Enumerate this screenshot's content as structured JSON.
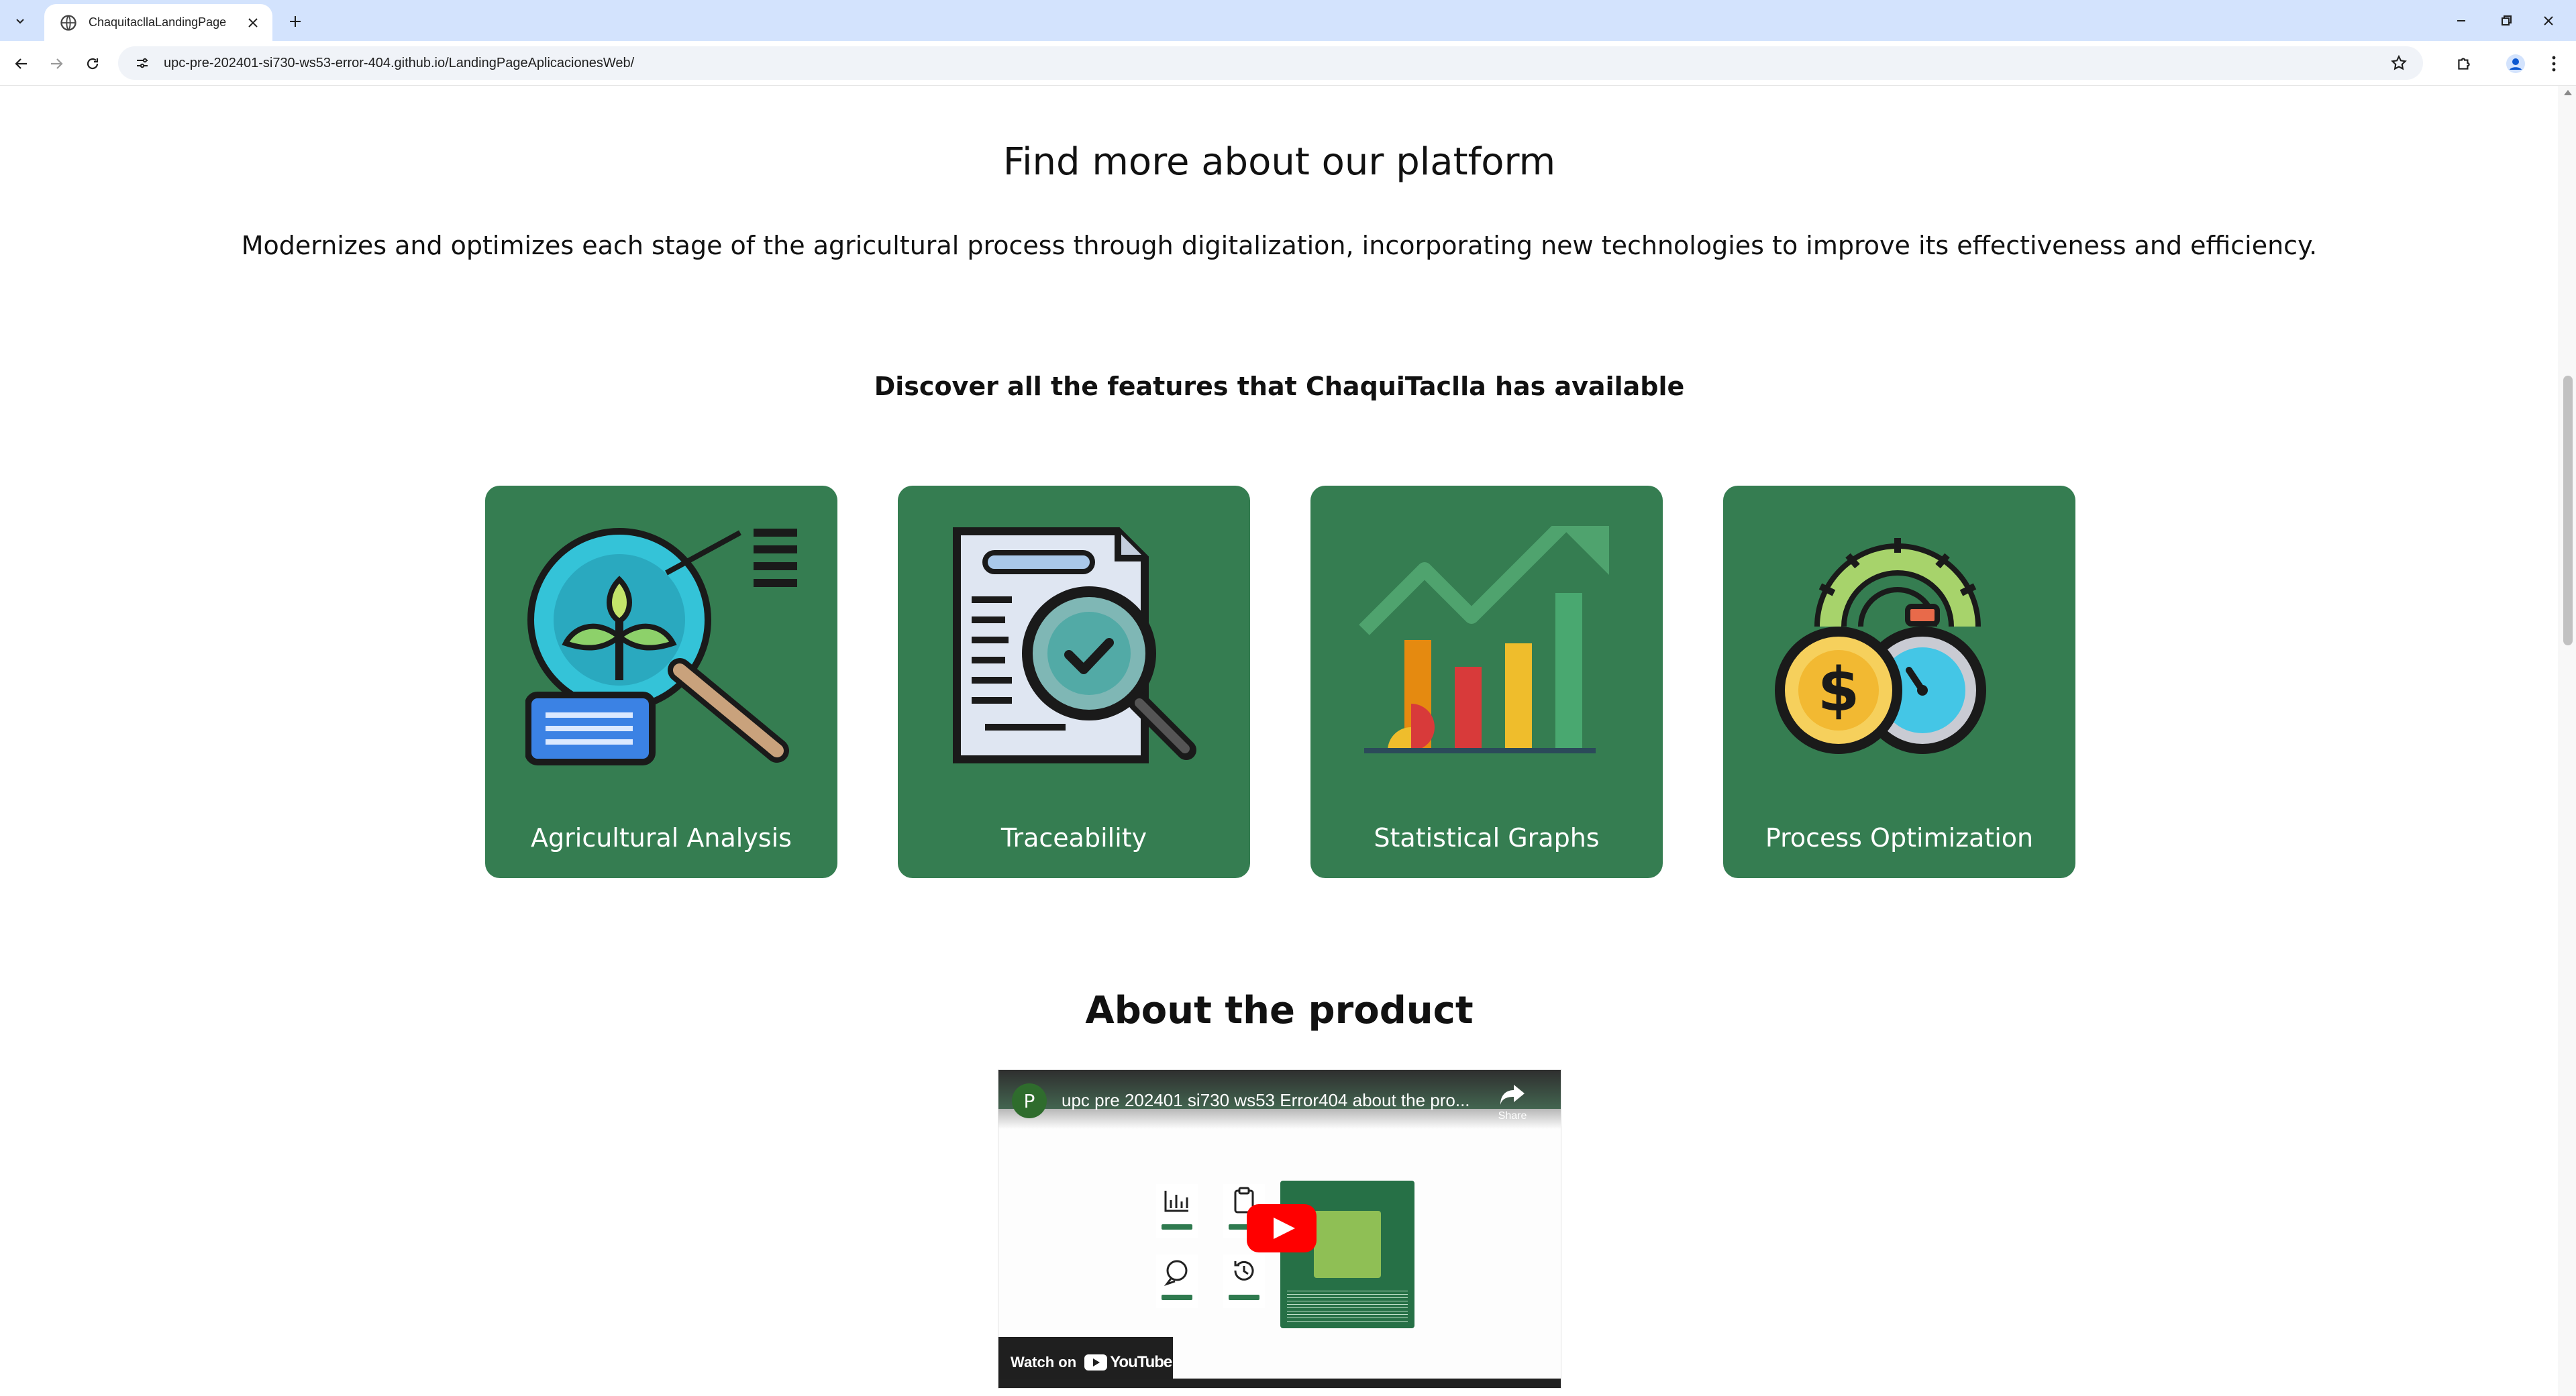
{
  "browser": {
    "tab_title": "ChaquitacllaLandingPage",
    "url": "upc-pre-202401-si730-ws53-error-404.github.io/LandingPageAplicacionesWeb/"
  },
  "platform": {
    "heading": "Find more about our platform",
    "description": "Modernizes and optimizes each stage of the agricultural process through digitalization, incorporating new technologies to improve its effectiveness and efficiency."
  },
  "features": {
    "heading": "Discover all the features that ChaquiTaclla has available",
    "cards": [
      {
        "label": "Agricultural Analysis",
        "icon": "magnifier-plant-icon"
      },
      {
        "label": "Traceability",
        "icon": "document-check-magnifier-icon"
      },
      {
        "label": "Statistical Graphs",
        "icon": "bar-chart-trend-icon"
      },
      {
        "label": "Process Optimization",
        "icon": "gear-coin-stopwatch-icon"
      }
    ],
    "card_color": "#357d51"
  },
  "about": {
    "heading": "About the product",
    "video": {
      "channel_initial": "P",
      "title": "upc pre 202401 si730 ws53 Error404 about the pro...",
      "share_label": "Share",
      "watch_label": "Watch on",
      "youtube_label": "YouTube"
    }
  }
}
